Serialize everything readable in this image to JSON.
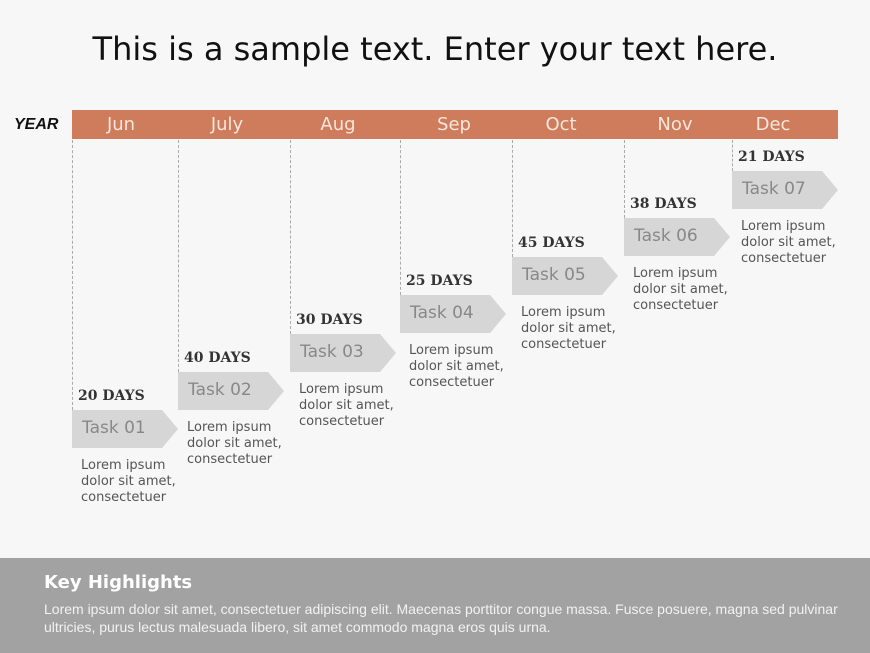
{
  "title": "This is a sample text. Enter your text here.",
  "timeline": {
    "year_label": "YEAR",
    "accent_color": "#cf7c5c",
    "months": [
      "Jun",
      "July",
      "Aug",
      "Sep",
      "Oct",
      "Nov",
      "Dec"
    ],
    "tasks": [
      {
        "duration": "20 DAYS",
        "label": "Task 01",
        "description": "Lorem ipsum dolor sit amet, consectetuer"
      },
      {
        "duration": "40 DAYS",
        "label": "Task 02",
        "description": "Lorem ipsum dolor sit amet, consectetuer"
      },
      {
        "duration": "30 DAYS",
        "label": "Task 03",
        "description": "Lorem ipsum dolor sit amet, consectetuer"
      },
      {
        "duration": "25 DAYS",
        "label": "Task 04",
        "description": "Lorem ipsum dolor sit amet, consectetuer"
      },
      {
        "duration": "45 DAYS",
        "label": "Task 05",
        "description": "Lorem ipsum dolor sit amet, consectetuer"
      },
      {
        "duration": "38 DAYS",
        "label": "Task 06",
        "description": "Lorem ipsum dolor sit amet, consectetuer"
      },
      {
        "duration": "21 DAYS",
        "label": "Task 07",
        "description": "Lorem ipsum dolor sit amet, consectetuer"
      }
    ]
  },
  "footer": {
    "heading": "Key Highlights",
    "body": "Lorem ipsum dolor sit amet, consectetuer adipiscing elit. Maecenas porttitor congue massa. Fusce posuere, magna sed pulvinar ultricies, purus lectus malesuada libero, sit amet commodo magna eros quis urna."
  }
}
